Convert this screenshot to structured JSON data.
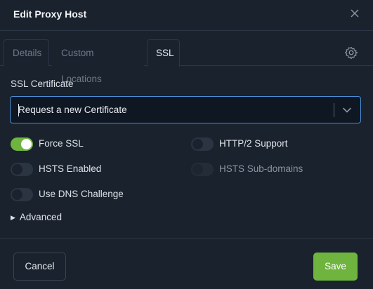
{
  "dialog": {
    "title": "Edit Proxy Host"
  },
  "tabs": [
    {
      "label": "Details",
      "active": false
    },
    {
      "label": "Custom Locations",
      "active": false
    },
    {
      "label": "SSL",
      "active": true
    }
  ],
  "ssl": {
    "certificate_label": "SSL Certificate",
    "certificate_value": "Request a new Certificate",
    "options": {
      "force_ssl": {
        "label": "Force SSL",
        "enabled": true,
        "disabled": false
      },
      "http2": {
        "label": "HTTP/2 Support",
        "enabled": false,
        "disabled": false
      },
      "hsts": {
        "label": "HSTS Enabled",
        "enabled": false,
        "disabled": false
      },
      "hsts_sub": {
        "label": "HSTS Sub-domains",
        "enabled": false,
        "disabled": true
      },
      "dns_challenge": {
        "label": "Use DNS Challenge",
        "enabled": false,
        "disabled": false
      }
    },
    "advanced_label": "Advanced"
  },
  "footer": {
    "cancel_label": "Cancel",
    "save_label": "Save"
  },
  "colors": {
    "accent_green": "#6fb43f",
    "focus_blue": "#4a90d9",
    "background": "#1a222e"
  },
  "icons": {
    "close": "close-icon",
    "settings": "gear-icon",
    "dropdown": "chevron-down-icon",
    "advanced": "triangle-right-icon"
  }
}
